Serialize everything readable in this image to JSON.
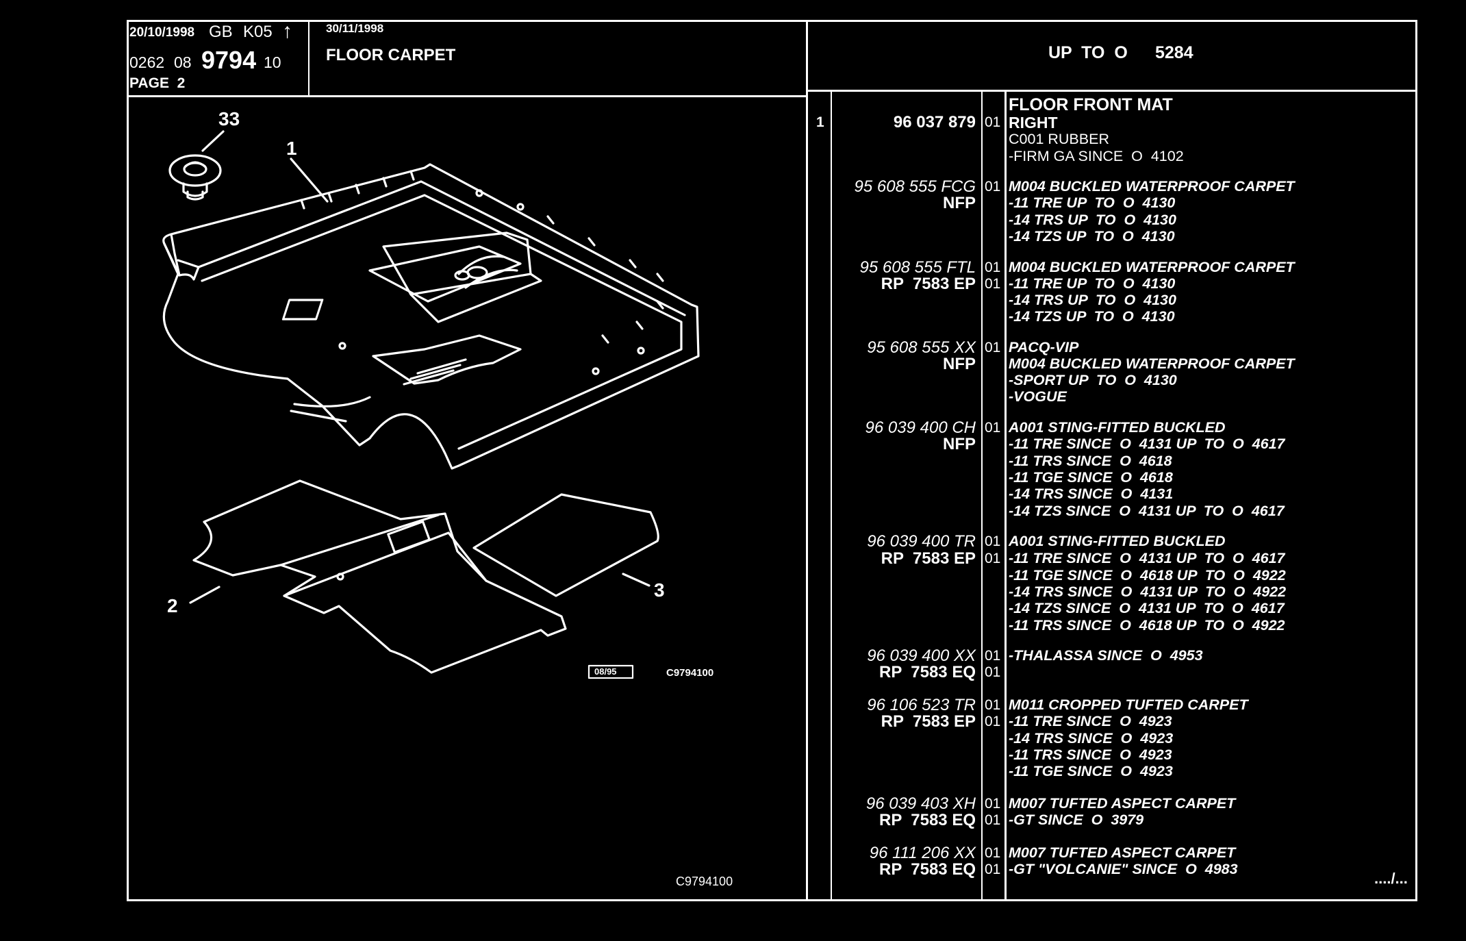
{
  "header": {
    "date1": "20/10/1998",
    "code_gb": "GB",
    "code_k05": "K05",
    "arrow": "↑",
    "ref_prefix": "0262",
    "ref_mid": "08",
    "ref_big": "9794",
    "ref_suffix": "10",
    "page": "PAGE  2",
    "date2": "30/11/1998",
    "title": "FLOOR CARPET",
    "range_label": "UP  TO  O",
    "range_value": "5284"
  },
  "diagram": {
    "callouts": [
      "33",
      "1",
      "2",
      "3"
    ],
    "stamp_box": "08/95",
    "stamp_code": "C9794100",
    "bottom_code": "C9794100"
  },
  "parts": {
    "ref_number": "1",
    "title": "FLOOR FRONT MAT",
    "rows": [
      {
        "pn": "96 037 879",
        "qty": "01",
        "desc": "RIGHT",
        "bold": true
      },
      {
        "pn": "",
        "qty": "",
        "desc": "C001 RUBBER",
        "bold": false
      },
      {
        "pn": "",
        "qty": "",
        "desc": "-FIRM GA SINCE  O  4102",
        "bold": false
      },
      {
        "pn": "95 608 555 FCG",
        "qty": "01",
        "desc": "M004 BUCKLED WATERPROOF CARPET",
        "italic": true
      },
      {
        "pn": "NFP",
        "qty": "",
        "desc": "-11 TRE UP  TO  O  4130",
        "italic": true
      },
      {
        "pn": "",
        "qty": "",
        "desc": "-14 TRS UP  TO  O  4130",
        "italic": true
      },
      {
        "pn": "",
        "qty": "",
        "desc": "-14 TZS UP  TO  O  4130",
        "italic": true
      },
      {
        "pn": "95 608 555 FTL",
        "qty": "01",
        "desc": "M004 BUCKLED WATERPROOF CARPET",
        "italic": true
      },
      {
        "pn": "RP  7583 EP",
        "qty": "01",
        "desc": "-11 TRE UP  TO  O  4130",
        "italic": true
      },
      {
        "pn": "",
        "qty": "",
        "desc": "-14 TRS UP  TO  O  4130",
        "italic": true
      },
      {
        "pn": "",
        "qty": "",
        "desc": "-14 TZS UP  TO  O  4130",
        "italic": true
      },
      {
        "pn": "95 608 555 XX",
        "qty": "01",
        "desc": "PACQ-VIP",
        "italic": true
      },
      {
        "pn": "NFP",
        "qty": "",
        "desc": "M004 BUCKLED WATERPROOF CARPET",
        "italic": true
      },
      {
        "pn": "",
        "qty": "",
        "desc": "-SPORT UP  TO  O  4130",
        "italic": true
      },
      {
        "pn": "",
        "qty": "",
        "desc": "-VOGUE",
        "italic": true
      },
      {
        "pn": "96 039 400 CH",
        "qty": "01",
        "desc": "A001 STING-FITTED BUCKLED",
        "italic": true
      },
      {
        "pn": "NFP",
        "qty": "",
        "desc": "-11 TRE SINCE  O  4131 UP  TO  O  4617",
        "italic": true
      },
      {
        "pn": "",
        "qty": "",
        "desc": "-11 TRS SINCE  O  4618",
        "italic": true
      },
      {
        "pn": "",
        "qty": "",
        "desc": "-11 TGE SINCE  O  4618",
        "italic": true
      },
      {
        "pn": "",
        "qty": "",
        "desc": "-14 TRS SINCE  O  4131",
        "italic": true
      },
      {
        "pn": "",
        "qty": "",
        "desc": "-14 TZS SINCE  O  4131 UP  TO  O  4617",
        "italic": true
      },
      {
        "pn": "96 039 400 TR",
        "qty": "01",
        "desc": "A001 STING-FITTED BUCKLED",
        "italic": true
      },
      {
        "pn": "RP  7583 EP",
        "qty": "01",
        "desc": "-11 TRE SINCE  O  4131 UP  TO  O  4617",
        "italic": true
      },
      {
        "pn": "",
        "qty": "",
        "desc": "-11 TGE SINCE  O  4618 UP  TO  O  4922",
        "italic": true
      },
      {
        "pn": "",
        "qty": "",
        "desc": "-14 TRS SINCE  O  4131 UP  TO  O  4922",
        "italic": true
      },
      {
        "pn": "",
        "qty": "",
        "desc": "-14 TZS SINCE  O  4131 UP  TO  O  4617",
        "italic": true
      },
      {
        "pn": "",
        "qty": "",
        "desc": "-11 TRS SINCE  O  4618 UP  TO  O  4922",
        "italic": true
      },
      {
        "pn": "96 039 400 XX",
        "qty": "01",
        "desc": "-THALASSA SINCE  O  4953",
        "italic": true
      },
      {
        "pn": "RP  7583 EQ",
        "qty": "01",
        "desc": "",
        "italic": true
      },
      {
        "pn": "96 106 523 TR",
        "qty": "01",
        "desc": "M011 CROPPED TUFTED CARPET",
        "italic": true
      },
      {
        "pn": "RP  7583 EP",
        "qty": "01",
        "desc": "-11 TRE SINCE  O  4923",
        "italic": true
      },
      {
        "pn": "",
        "qty": "",
        "desc": "-14 TRS SINCE  O  4923",
        "italic": true
      },
      {
        "pn": "",
        "qty": "",
        "desc": "-11 TRS SINCE  O  4923",
        "italic": true
      },
      {
        "pn": "",
        "qty": "",
        "desc": "-11 TGE SINCE  O  4923",
        "italic": true
      },
      {
        "pn": "96 039 403 XH",
        "qty": "01",
        "desc": "M007 TUFTED ASPECT CARPET",
        "italic": true
      },
      {
        "pn": "RP  7583 EQ",
        "qty": "01",
        "desc": "-GT SINCE  O  3979",
        "italic": true
      },
      {
        "pn": "96 111 206 XX",
        "qty": "01",
        "desc": "M007 TUFTED ASPECT CARPET",
        "italic": true
      },
      {
        "pn": "RP  7583 EQ",
        "qty": "01",
        "desc": "-GT \"VOLCANIE\" SINCE  O  4983",
        "italic": true
      }
    ],
    "continued": "..../..."
  }
}
